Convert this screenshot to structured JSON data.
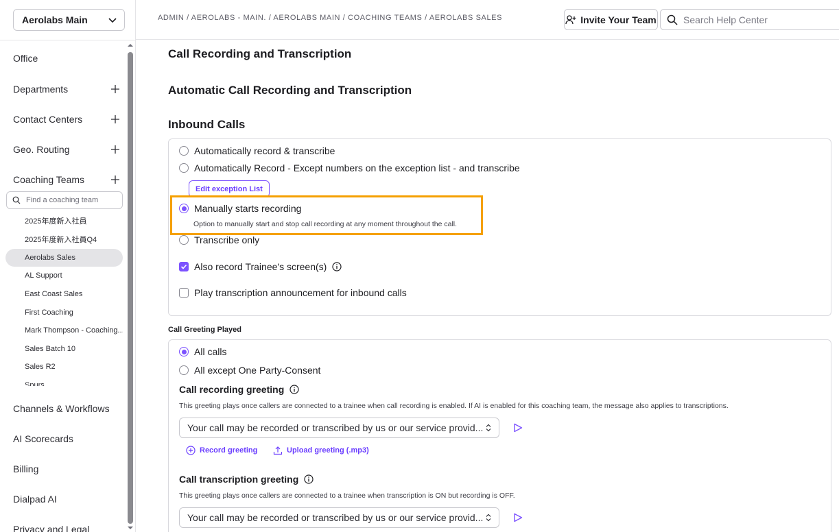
{
  "sidebar": {
    "org_select": "Aerolabs Main",
    "nav_top": [
      {
        "label": "Office",
        "has_plus": false
      },
      {
        "label": "Departments",
        "has_plus": true
      },
      {
        "label": "Contact Centers",
        "has_plus": true
      },
      {
        "label": "Geo. Routing",
        "has_plus": true
      },
      {
        "label": "Coaching Teams",
        "has_plus": true
      }
    ],
    "coach_search_placeholder": "Find a coaching team",
    "teams": [
      "2025年度新入社員",
      "2025年度新入社員Q4",
      "Aerolabs Sales",
      "AL Support",
      "East Coast Sales",
      "First Coaching",
      "Mark Thompson - Coaching...",
      "Sales Batch 10",
      "Sales R2",
      "Spurs"
    ],
    "active_team": "Aerolabs Sales",
    "nav_bottom": [
      "Channels & Workflows",
      "AI Scorecards",
      "Billing",
      "Dialpad AI",
      "Privacy and Legal"
    ]
  },
  "header": {
    "breadcrumb": "ADMIN / AEROLABS - MAIN. / AEROLABS MAIN / COACHING TEAMS / AEROLABS SALES",
    "invite_label": "Invite Your Team",
    "help_search_placeholder": "Search Help Center"
  },
  "main": {
    "section_title": "Call Recording and Transcription",
    "auto_title": "Automatic Call Recording and Transcription",
    "inbound_title": "Inbound Calls",
    "inbound_options": {
      "auto_record": "Automatically record & transcribe",
      "auto_except": "Automatically Record - Except numbers on the exception list - and transcribe",
      "edit_exception": "Edit exception List",
      "manual": "Manually starts recording",
      "manual_desc": "Option to manually start and stop call recording at any moment throughout the call.",
      "transcribe_only": "Transcribe only",
      "record_screen": "Also record Trainee's screen(s)",
      "play_announcement": "Play transcription announcement for inbound calls",
      "selected": "manual"
    },
    "greeting_title": "Call Greeting Played",
    "greeting": {
      "all_calls": "All calls",
      "except_one_party": "All except One Party-Consent",
      "recording_title": "Call recording greeting",
      "recording_desc": "This greeting plays once callers are connected to a trainee when call recording is enabled. If AI is enabled for this coaching team, the message also applies to transcriptions.",
      "recording_select": "Your call may be recorded or transcribed by us or our service provid...",
      "record_greeting": "Record greeting",
      "upload_greeting": "Upload greeting (.mp3)",
      "transcription_title": "Call transcription greeting",
      "transcription_desc": "This greeting plays once callers are connected to a trainee when transcription is ON but recording is OFF.",
      "transcription_select": "Your call may be recorded or transcribed by us or our service provid..."
    }
  },
  "colors": {
    "accent": "#7c52ff",
    "highlight": "#f5a000"
  }
}
